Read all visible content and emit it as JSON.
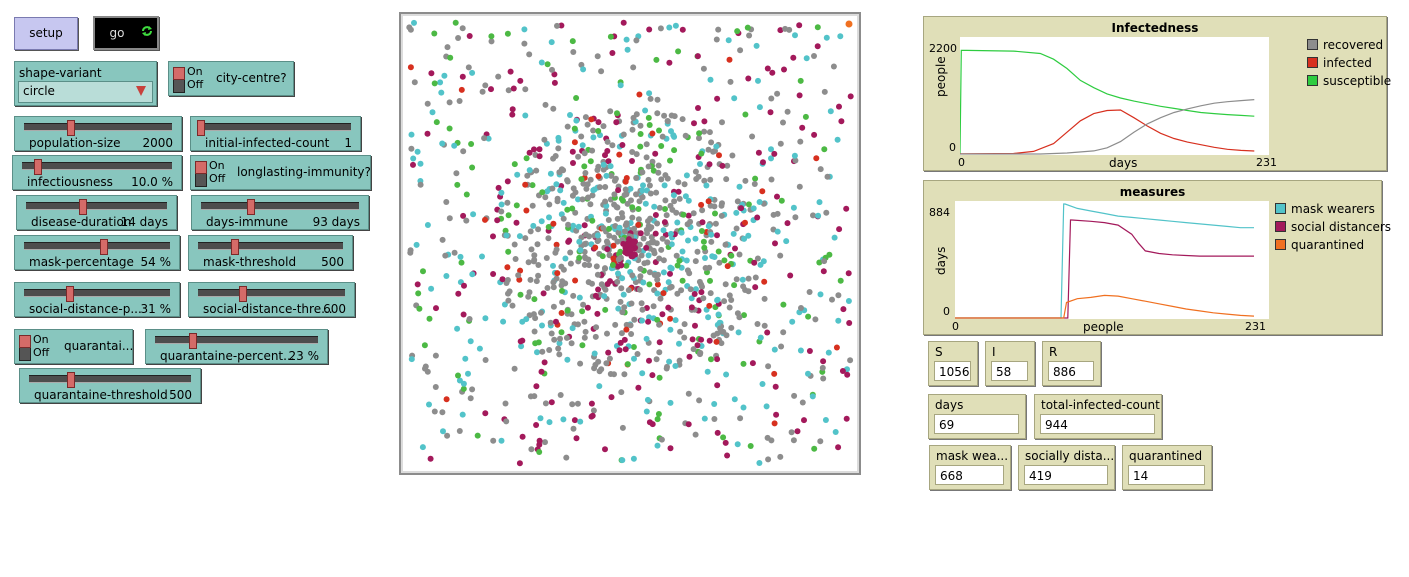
{
  "buttons": {
    "setup": "setup",
    "go": "go"
  },
  "chooser": {
    "name": "shape-variant",
    "value": "circle"
  },
  "switches": {
    "on_label": "On",
    "off_label": "Off",
    "city_centre": "city-centre?",
    "longlasting_immunity": "longlasting-immunity?",
    "quarantine": "quarantai..."
  },
  "sliders": {
    "population_size": {
      "name": "population-size",
      "value": "2000",
      "pos": 0.31
    },
    "initial_infected_count": {
      "name": "initial-infected-count",
      "value": "1",
      "pos": 0.0
    },
    "infectiousness": {
      "name": "infectiousness",
      "value": "10.0 %",
      "pos": 0.1
    },
    "disease_duration": {
      "name": "disease-duration",
      "value": "14 days",
      "pos": 0.4
    },
    "days_immune": {
      "name": "days-immune",
      "value": "93 days",
      "pos": 0.31
    },
    "mask_percentage": {
      "name": "mask-percentage",
      "value": "54 %",
      "pos": 0.54
    },
    "mask_threshold": {
      "name": "mask-threshold",
      "value": "500",
      "pos": 0.25
    },
    "social_distance_percentage": {
      "name": "social-distance-p...",
      "value": "31 %",
      "pos": 0.31
    },
    "social_distance_threshold": {
      "name": "social-distance-thre...",
      "value": "600",
      "pos": 0.3
    },
    "quarantine_percentage": {
      "name": "quarantaine-percent...",
      "value": "23 %",
      "pos": 0.23
    },
    "quarantine_threshold": {
      "name": "quarantaine-threshold",
      "value": "500",
      "pos": 0.25
    }
  },
  "plots": {
    "infectedness": {
      "title": "Infectedness",
      "ylabel": "people",
      "xlabel": "days",
      "ymax_label": "2200",
      "ymin_label": "0",
      "xmin_label": "0",
      "xmax_label": "231",
      "legend": [
        {
          "name": "recovered",
          "color": "#8d8d8d"
        },
        {
          "name": "infected",
          "color": "#d7301f"
        },
        {
          "name": "susceptible",
          "color": "#2ecc40"
        }
      ]
    },
    "measures": {
      "title": "measures",
      "ylabel": "days",
      "xlabel": "people",
      "ymax_label": "884",
      "ymin_label": "0",
      "xmin_label": "0",
      "xmax_label": "231",
      "legend": [
        {
          "name": "mask wearers",
          "color": "#52c3c9"
        },
        {
          "name": "social distancers",
          "color": "#a3195b"
        },
        {
          "name": "quarantined",
          "color": "#f07020"
        }
      ]
    }
  },
  "chart_data": [
    {
      "type": "line",
      "title": "Infectedness",
      "xlabel": "days",
      "ylabel": "people",
      "xlim": [
        0,
        231
      ],
      "ylim": [
        0,
        2200
      ],
      "legend": "right",
      "series": [
        {
          "name": "susceptible",
          "color": "#2ecc40",
          "x": [
            0,
            1,
            5,
            40,
            60,
            70,
            80,
            90,
            100,
            110,
            120,
            130,
            140,
            150,
            160,
            170,
            180,
            190,
            200,
            210,
            220
          ],
          "y": [
            0,
            1999,
            1999,
            1985,
            1940,
            1830,
            1650,
            1420,
            1280,
            1160,
            1080,
            1020,
            970,
            920,
            880,
            840,
            800,
            780,
            760,
            745,
            730
          ]
        },
        {
          "name": "infected",
          "color": "#d7301f",
          "x": [
            0,
            40,
            55,
            70,
            80,
            90,
            100,
            110,
            120,
            130,
            140,
            150,
            160,
            170,
            180,
            190,
            200,
            210,
            220
          ],
          "y": [
            1,
            10,
            50,
            200,
            420,
            640,
            780,
            840,
            850,
            700,
            540,
            400,
            300,
            230,
            180,
            130,
            90,
            70,
            58
          ]
        },
        {
          "name": "recovered",
          "color": "#8d8d8d",
          "x": [
            0,
            60,
            80,
            100,
            110,
            120,
            130,
            140,
            150,
            160,
            170,
            180,
            190,
            200,
            210,
            220
          ],
          "y": [
            0,
            0,
            20,
            60,
            120,
            240,
            420,
            580,
            700,
            800,
            870,
            930,
            980,
            1010,
            1030,
            1050
          ]
        }
      ]
    },
    {
      "type": "line",
      "title": "measures",
      "xlabel": "people",
      "ylabel": "days",
      "xlim": [
        0,
        231
      ],
      "ylim": [
        0,
        884
      ],
      "legend": "right",
      "series": [
        {
          "name": "mask wearers",
          "color": "#52c3c9",
          "x": [
            0,
            78,
            80,
            81,
            90,
            100,
            110,
            120,
            130,
            140,
            150,
            160,
            170,
            180,
            190,
            200,
            210,
            220
          ],
          "y": [
            0,
            0,
            884,
            884,
            850,
            830,
            810,
            790,
            780,
            770,
            760,
            750,
            740,
            730,
            720,
            710,
            700,
            700
          ]
        },
        {
          "name": "social distancers",
          "color": "#a3195b",
          "x": [
            0,
            83,
            85,
            86,
            100,
            110,
            120,
            130,
            135,
            140,
            150,
            160,
            170,
            180,
            190,
            200,
            210,
            220
          ],
          "y": [
            0,
            0,
            760,
            760,
            750,
            740,
            720,
            650,
            580,
            520,
            500,
            490,
            485,
            480,
            480,
            480,
            480,
            480
          ]
        },
        {
          "name": "quarantined",
          "color": "#f07020",
          "x": [
            0,
            80,
            82,
            90,
            100,
            110,
            120,
            130,
            140,
            150,
            160,
            170,
            180,
            190,
            200,
            210,
            220
          ],
          "y": [
            0,
            0,
            120,
            150,
            160,
            175,
            170,
            150,
            130,
            110,
            90,
            70,
            55,
            40,
            30,
            20,
            15
          ]
        }
      ]
    }
  ],
  "monitors": {
    "s": {
      "label": "S",
      "value": "1056"
    },
    "i": {
      "label": "I",
      "value": "58"
    },
    "r": {
      "label": "R",
      "value": "886"
    },
    "days": {
      "label": "days",
      "value": "69"
    },
    "total_infected": {
      "label": "total-infected-count",
      "value": "944"
    },
    "mask_wearers": {
      "label": "mask wea...",
      "value": "668"
    },
    "socially_distanced": {
      "label": "socially dista...",
      "value": "419"
    },
    "quarantined": {
      "label": "quarantined",
      "value": "14"
    }
  },
  "world": {
    "agent_colors": [
      "#8d8d8d",
      "#52c3c9",
      "#a3195b",
      "#4cb944",
      "#d7301f"
    ]
  }
}
